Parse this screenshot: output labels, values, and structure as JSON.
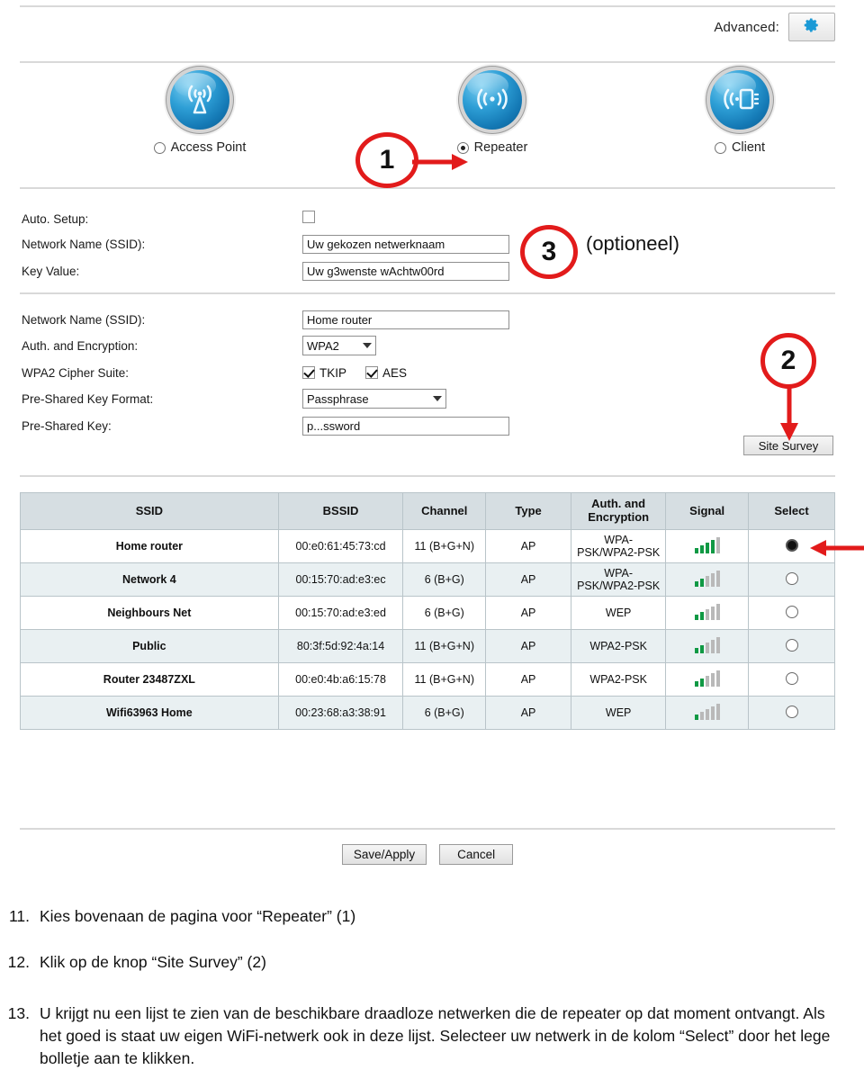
{
  "router": {
    "advanced": {
      "label": "Advanced:",
      "icon": "gear-icon"
    },
    "modes": [
      {
        "id": "access-point",
        "label": "Access Point",
        "selected": false,
        "icon": "wifi-broadcast-icon"
      },
      {
        "id": "repeater",
        "label": "Repeater",
        "selected": true,
        "icon": "wifi-repeater-icon"
      },
      {
        "id": "client",
        "label": "Client",
        "selected": false,
        "icon": "wifi-client-device-icon"
      }
    ],
    "form_top": {
      "auto_setup": {
        "label": "Auto. Setup:",
        "checked": false
      },
      "ssid": {
        "label": "Network Name (SSID):",
        "value": "Uw gekozen netwerknaam"
      },
      "key_value": {
        "label": "Key Value:",
        "value": "Uw g3wenste wAchtw00rd"
      }
    },
    "form_bottom": {
      "ssid": {
        "label": "Network Name (SSID):",
        "value": "Home router"
      },
      "auth": {
        "label": "Auth. and Encryption:",
        "value": "WPA2"
      },
      "cipher": {
        "label": "WPA2 Cipher Suite:",
        "tkip": "TKIP",
        "tkip_checked": true,
        "aes": "AES",
        "aes_checked": true
      },
      "psk_format": {
        "label": "Pre-Shared Key Format:",
        "value": "Passphrase"
      },
      "psk": {
        "label": "Pre-Shared Key:",
        "value": "p...ssword"
      }
    },
    "site_survey_button": "Site Survey",
    "table": {
      "headers": [
        "SSID",
        "BSSID",
        "Channel",
        "Type",
        "Auth. and Encryption",
        "Signal",
        "Select"
      ],
      "header_auth_line1": "Auth. and",
      "header_auth_line2": "Encryption",
      "rows": [
        {
          "ssid": "Home router",
          "bssid": "00:e0:61:45:73:cd",
          "channel": "11 (B+G+N)",
          "type": "AP",
          "auth": "WPA-PSK/WPA2-PSK",
          "signal_bars": 4,
          "selected": true
        },
        {
          "ssid": "Network 4",
          "bssid": "00:15:70:ad:e3:ec",
          "channel": "6 (B+G)",
          "type": "AP",
          "auth": "WPA-PSK/WPA2-PSK",
          "signal_bars": 2,
          "selected": false
        },
        {
          "ssid": "Neighbours Net",
          "bssid": "00:15:70:ad:e3:ed",
          "channel": "6 (B+G)",
          "type": "AP",
          "auth": "WEP",
          "signal_bars": 2,
          "selected": false
        },
        {
          "ssid": "Public",
          "bssid": "80:3f:5d:92:4a:14",
          "channel": "11 (B+G+N)",
          "type": "AP",
          "auth": "WPA2-PSK",
          "signal_bars": 2,
          "selected": false
        },
        {
          "ssid": "Router 23487ZXL",
          "bssid": "00:e0:4b:a6:15:78",
          "channel": "11 (B+G+N)",
          "type": "AP",
          "auth": "WPA2-PSK",
          "signal_bars": 2,
          "selected": false
        },
        {
          "ssid": "Wifi63963 Home",
          "bssid": "00:23:68:a3:38:91",
          "channel": "6 (B+G)",
          "type": "AP",
          "auth": "WEP",
          "signal_bars": 1,
          "selected": false
        }
      ]
    },
    "actions": {
      "save": "Save/Apply",
      "cancel": "Cancel"
    }
  },
  "annotations": {
    "one": "1",
    "two": "2",
    "three": "3",
    "optional_note": "(optioneel)",
    "color": "#e21b1b"
  },
  "instructions": [
    {
      "num": "11.",
      "text": "Kies bovenaan de pagina voor  “Repeater”  (1)"
    },
    {
      "num": "12.",
      "text": "Klik op de knop “Site Survey” (2)"
    },
    {
      "num": "13.",
      "text": "U krijgt nu een lijst te zien van de beschikbare draadloze netwerken die de repeater op dat moment ontvangt. Als het goed is staat uw eigen WiFi-netwerk ook in deze lijst. Selecteer uw netwerk in de kolom “Select” door het lege bolletje aan te klikken."
    }
  ]
}
